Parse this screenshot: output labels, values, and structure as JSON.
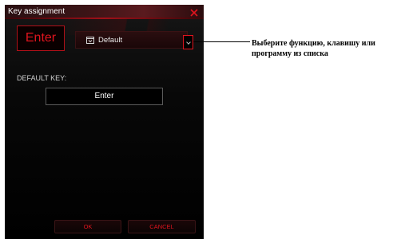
{
  "dialog": {
    "title": "Key assignment",
    "close_icon": "close-icon",
    "selected_key": "Enter",
    "function_select": {
      "value": "Default",
      "icon": "window-icon"
    },
    "dropdown_icon": "chevron-down-icon",
    "default_key_label": "DEFAULT KEY:",
    "default_key_value": "Enter",
    "ok_label": "OK",
    "cancel_label": "CANCEL",
    "accent_color": "#e0141e"
  },
  "callout": {
    "text": "Выберите функцию, клавишу или программу из списка"
  }
}
